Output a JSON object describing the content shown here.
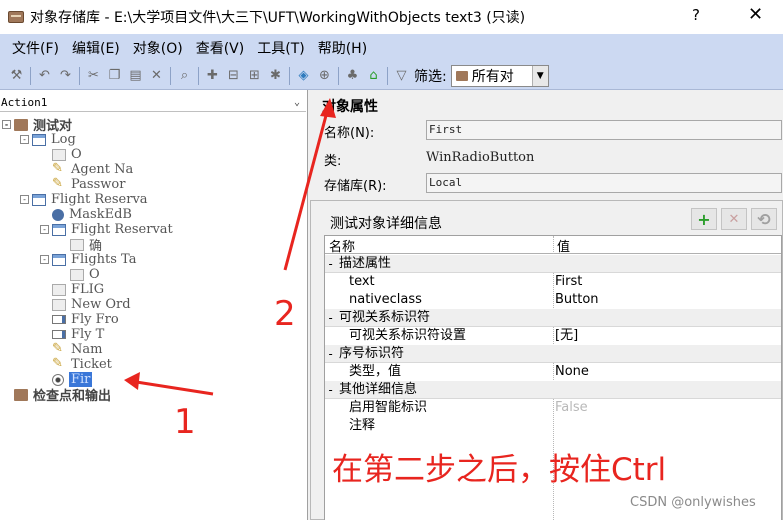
{
  "window": {
    "title": "对象存储库 - E:\\大学项目文件\\大三下\\UFT\\WorkingWithObjects text3 (只读)",
    "help_glyph": "?",
    "close_glyph": "✕"
  },
  "menu": [
    "文件(F)",
    "编辑(E)",
    "对象(O)",
    "查看(V)",
    "工具(T)",
    "帮助(H)"
  ],
  "toolbar": {
    "filter_label": "筛选:",
    "filter_value": "所有对",
    "icons": [
      "tools-icon",
      "undo-icon",
      "redo-icon",
      "cut-icon",
      "copy-icon",
      "paste-icon",
      "delete-icon",
      "find-icon",
      "add-object-icon",
      "update-icon",
      "highlight-icon",
      "locate-icon",
      "object-spy-icon",
      "define-object-icon",
      "merge-icon",
      "export-icon",
      "filter-icon"
    ]
  },
  "left_pane": {
    "action": "Action1",
    "tree": [
      {
        "label": "测试对",
        "icon": "root",
        "level": 0,
        "bold": true,
        "expander": "-"
      },
      {
        "label": "Log",
        "icon": "win",
        "level": 1,
        "expander": "-"
      },
      {
        "label": "O",
        "icon": "box",
        "level": 2
      },
      {
        "label": "Agent Na",
        "icon": "edit",
        "level": 2
      },
      {
        "label": "Passwor",
        "icon": "edit",
        "level": 2
      },
      {
        "label": "Flight Reserva",
        "icon": "win",
        "level": 1,
        "expander": "-"
      },
      {
        "label": "MaskEdB",
        "icon": "mask",
        "level": 2
      },
      {
        "label": "Flight Reservat",
        "icon": "win",
        "level": 2,
        "expander": "-"
      },
      {
        "label": "确",
        "icon": "box",
        "level": 3
      },
      {
        "label": "Flights Ta",
        "icon": "win",
        "level": 2,
        "expander": "-"
      },
      {
        "label": "O",
        "icon": "box",
        "level": 3
      },
      {
        "label": "FLIG",
        "icon": "box",
        "level": 2
      },
      {
        "label": "New Ord",
        "icon": "box",
        "level": 2
      },
      {
        "label": "Fly Fro",
        "icon": "combo",
        "level": 2
      },
      {
        "label": "Fly T",
        "icon": "combo",
        "level": 2
      },
      {
        "label": "Nam",
        "icon": "edit",
        "level": 2
      },
      {
        "label": "Ticket",
        "icon": "edit",
        "level": 2
      },
      {
        "label": "Fir",
        "icon": "radio",
        "level": 2,
        "selected": true
      },
      {
        "label": "检查点和输出",
        "icon": "root",
        "level": 0,
        "bold": true
      }
    ]
  },
  "properties": {
    "title": "对象属性",
    "name_label": "名称(N):",
    "name_value": "First",
    "class_label": "类:",
    "class_value": "WinRadioButton",
    "repo_label": "存储库(R):",
    "repo_value": "Local"
  },
  "details": {
    "title": "测试对象详细信息",
    "add_glyph": "+",
    "remove_glyph": "✕",
    "refresh_glyph": "⟲",
    "col_name": "名称",
    "col_value": "值",
    "rows": [
      {
        "type": "group",
        "expander": "-",
        "name": "描述属性"
      },
      {
        "type": "prop",
        "name": "text",
        "value": "First"
      },
      {
        "type": "prop",
        "name": "nativeclass",
        "value": "Button"
      },
      {
        "type": "group",
        "expander": "-",
        "name": "可视关系标识符"
      },
      {
        "type": "prop",
        "name": "可视关系标识符设置",
        "value": "[无]"
      },
      {
        "type": "group",
        "expander": "-",
        "name": "序号标识符"
      },
      {
        "type": "prop",
        "name": "类型，值",
        "value": "None"
      },
      {
        "type": "group",
        "expander": "-",
        "name": "其他详细信息"
      },
      {
        "type": "prop",
        "name": "启用智能标识",
        "value": "False",
        "disabled": true
      },
      {
        "type": "prop",
        "name": "注释",
        "value": ""
      }
    ]
  },
  "annotations": {
    "step1": "1",
    "step2": "2",
    "note": "在第二步之后，按住Ctrl",
    "color": "#e8251f"
  },
  "watermark": "CSDN @onlywishes"
}
